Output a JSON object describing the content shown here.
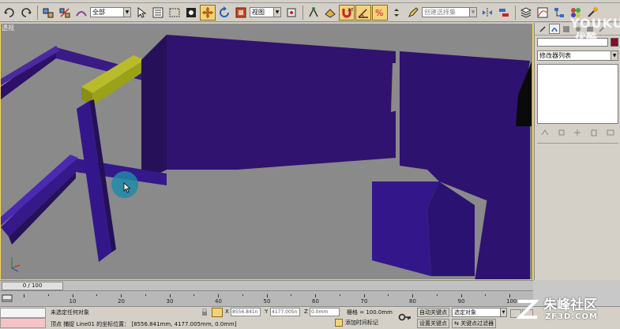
{
  "toolbar": {
    "selection_filter": "全部",
    "ref_coord": "视图",
    "named_selection_placeholder": "创建选择集"
  },
  "viewport": {
    "label": "透视"
  },
  "command_panel": {
    "modifier_list": "修改器列表",
    "object_color": "#8b0a2d"
  },
  "timeline": {
    "frame_display": "0 / 100",
    "ruler_labels": [
      "10",
      "20",
      "30",
      "40",
      "50",
      "60",
      "70",
      "80",
      "90",
      "100"
    ]
  },
  "status": {
    "selection_text": "未选定任何对象",
    "prompt_text": "顶点 捕捉 Line01 的坐标位置： [8556.841mm, 4177.005mm, 0.0mm]",
    "x_label": "X",
    "x_value": "8556.841n",
    "y_label": "Y",
    "y_value": "4177.005n",
    "z_label": "Z",
    "z_value": "0.0mm",
    "grid_text": "栅格 = 100.0mm",
    "add_time_tag": "添加时间标记",
    "auto_key": "自动关键点",
    "set_key": "设置关键点",
    "selected_dropdown": "选定对象",
    "key_filters": "关键点过滤器"
  },
  "watermarks": {
    "youku": "YOUKU",
    "youku_cn": "优酷",
    "zf_big": "朱峰社区",
    "zf_small": "ZF3D.COM"
  },
  "colors": {
    "accent_yellow": "#f3d27a",
    "wall_purple": "#30136f",
    "beam_yellow": "#9aa21a",
    "cursor_halo": "#1e8aa8",
    "listener_pink": "#f6c4c8"
  }
}
